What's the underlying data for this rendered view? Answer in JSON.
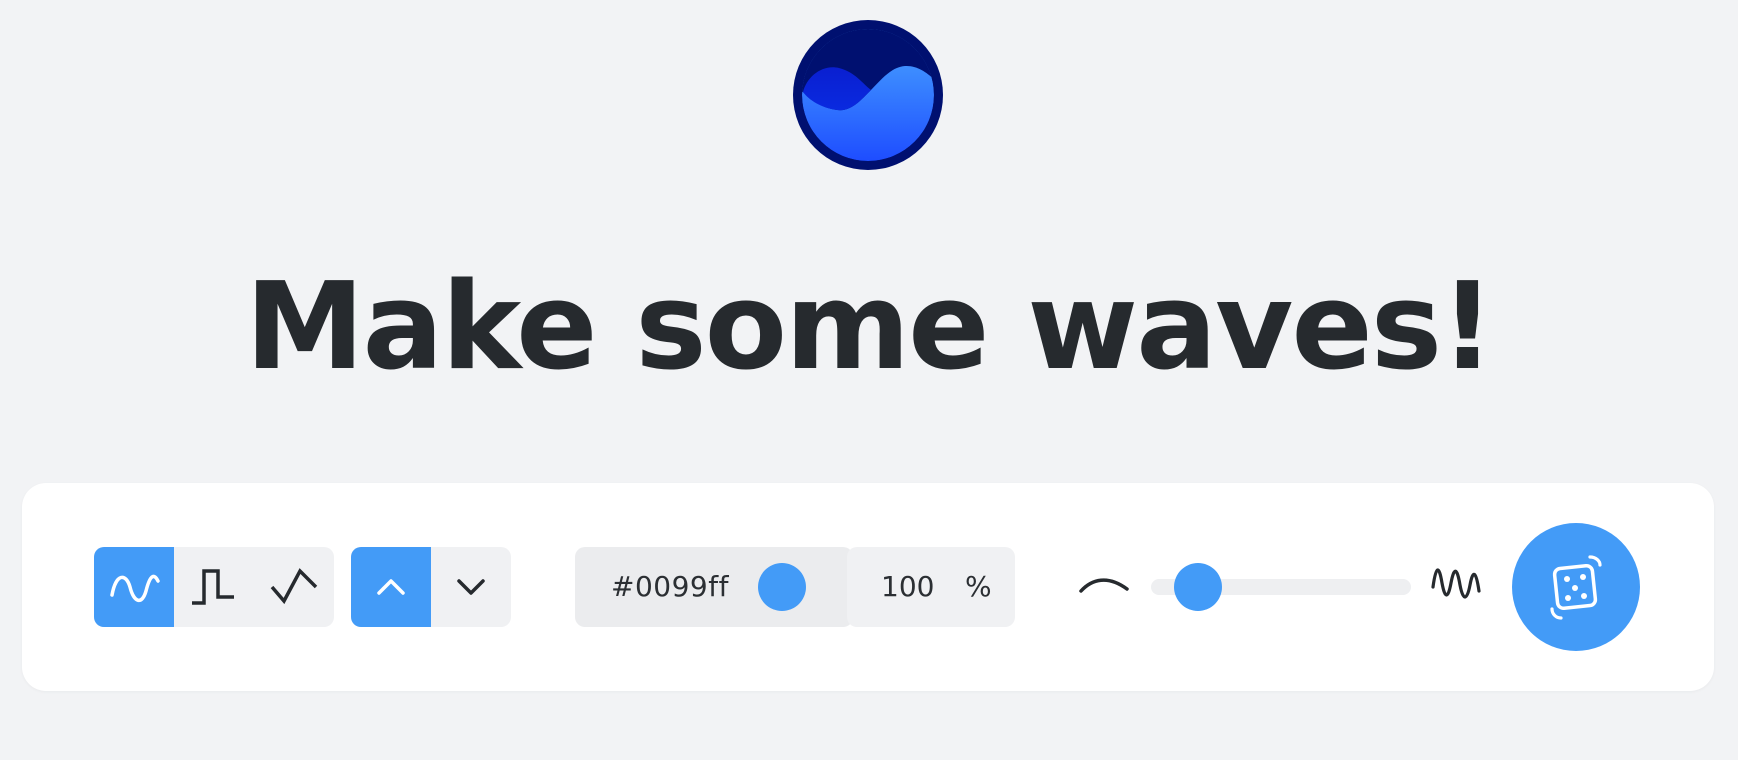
{
  "headline": "Make some waves!",
  "colors": {
    "accent": "#439bf7",
    "text": "#262a2e",
    "background": "#f2f3f5",
    "logo_dark": "#001070",
    "logo_light": "#3a8cf8"
  },
  "toolbar": {
    "wave_types": [
      {
        "name": "sine",
        "icon": "sine-wave-icon",
        "active": true
      },
      {
        "name": "square",
        "icon": "square-wave-icon",
        "active": false
      },
      {
        "name": "triangle",
        "icon": "triangle-wave-icon",
        "active": false
      }
    ],
    "direction": [
      {
        "name": "up",
        "icon": "chevron-up-icon",
        "active": true
      },
      {
        "name": "down",
        "icon": "chevron-down-icon",
        "active": false
      }
    ],
    "color_value": "#0099ff",
    "opacity_value": "100",
    "opacity_unit": "%",
    "complexity_slider": {
      "min_icon": "smooth-curve-icon",
      "max_icon": "wavy-line-icon",
      "value": 0.18
    },
    "randomize_icon": "dice-icon"
  }
}
